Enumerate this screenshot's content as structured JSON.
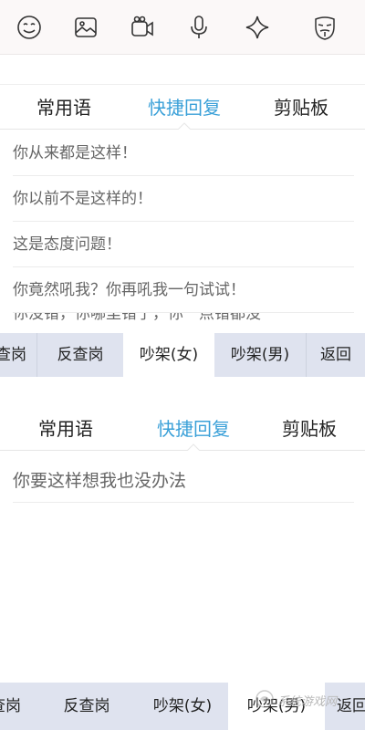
{
  "toolbar": {
    "icons": [
      "smiley-icon",
      "image-icon",
      "video-camera-icon",
      "microphone-icon",
      "sparkle-icon",
      "mask-icon"
    ]
  },
  "top_panel": {
    "tabs": [
      {
        "label": "常用语",
        "active": false
      },
      {
        "label": "快捷回复",
        "active": true
      },
      {
        "label": "剪贴板",
        "active": false
      }
    ],
    "phrases": [
      "你从来都是这样！",
      "你以前不是这样的！",
      "这是态度问题！",
      "你竟然吼我？你再吼我一句试试！",
      "你没错，你哪里错了，你一点错都没"
    ],
    "categories": [
      {
        "label": "查岗",
        "selected": false
      },
      {
        "label": "反查岗",
        "selected": false
      },
      {
        "label": "吵架(女)",
        "selected": true
      },
      {
        "label": "吵架(男)",
        "selected": false
      },
      {
        "label": "返回",
        "selected": false
      }
    ]
  },
  "bottom_panel": {
    "tabs": [
      {
        "label": "常用语",
        "active": false
      },
      {
        "label": "快捷回复",
        "active": true
      },
      {
        "label": "剪贴板",
        "active": false
      }
    ],
    "phrases": [
      "你要这样想我也没办法"
    ],
    "categories": [
      {
        "label": "查岗",
        "selected": false
      },
      {
        "label": "反查岗",
        "selected": false
      },
      {
        "label": "吵架(女)",
        "selected": false
      },
      {
        "label": "吵架(男)",
        "selected": true
      },
      {
        "label": "返回",
        "selected": false
      }
    ]
  },
  "watermark": {
    "text": "系统游戏网",
    "logo_name": "watermark-logo"
  },
  "colors": {
    "accent": "#3aa0d8",
    "category_bar": "#dfe3ef",
    "toolbar_bg": "#fbf8f8"
  }
}
